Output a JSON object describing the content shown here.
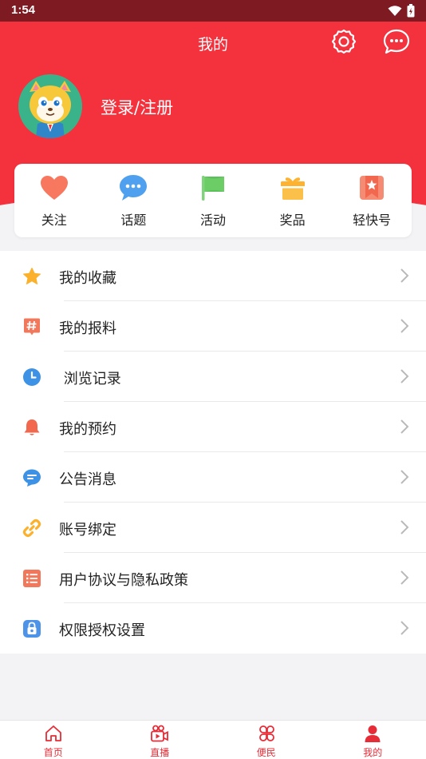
{
  "status_bar": {
    "time": "1:54"
  },
  "header": {
    "title": "我的",
    "login_text": "登录/注册",
    "bg_color": "#f4323e"
  },
  "quick_actions": [
    {
      "label": "关注",
      "icon": "heart-icon"
    },
    {
      "label": "话题",
      "icon": "chat-bubble-icon"
    },
    {
      "label": "活动",
      "icon": "flag-icon"
    },
    {
      "label": "奖品",
      "icon": "gift-icon"
    },
    {
      "label": "轻快号",
      "icon": "bookmark-star-icon"
    }
  ],
  "menu": [
    {
      "label": "我的收藏",
      "icon": "star-icon"
    },
    {
      "label": "我的报料",
      "icon": "hashtag-icon"
    },
    {
      "label": " 浏览记录",
      "icon": "clock-icon"
    },
    {
      "label": "我的预约",
      "icon": "bell-icon"
    },
    {
      "label": "公告消息",
      "icon": "message-icon"
    },
    {
      "label": "账号绑定",
      "icon": "link-icon"
    },
    {
      "label": "用户协议与隐私政策",
      "icon": "list-icon"
    },
    {
      "label": "权限授权设置",
      "icon": "lock-icon"
    }
  ],
  "tabs": [
    {
      "label": "首页",
      "icon": "home-icon"
    },
    {
      "label": "直播",
      "icon": "video-icon"
    },
    {
      "label": "便民",
      "icon": "clover-icon"
    },
    {
      "label": "我的",
      "icon": "person-icon",
      "active": true
    }
  ]
}
